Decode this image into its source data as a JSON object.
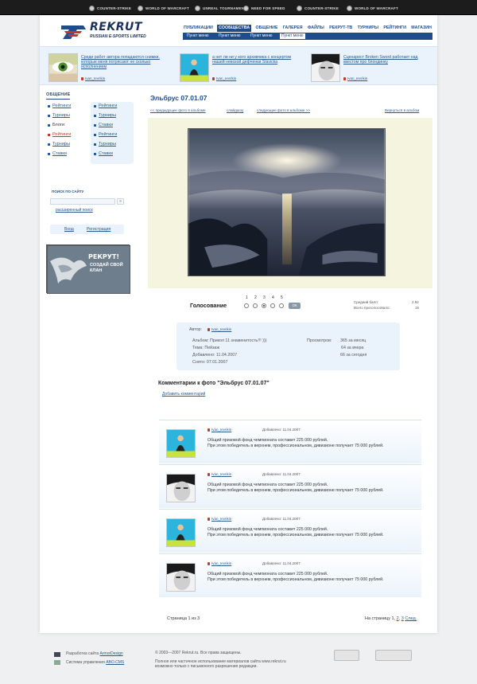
{
  "topbar": {
    "items": [
      "COUNTER-STRIKE",
      "WORLD OF WARCRAFT",
      "UNREAL TOURNAMENT",
      "NEED FOR SPEED",
      "COUNTER-STRIKE",
      "WORLD OF WARCRAFT"
    ]
  },
  "logo": {
    "name": "REKRUT",
    "subtitle": "RUSSIAN E-SPORTS LIMITED"
  },
  "nav": {
    "items": [
      "ПУБЛИКАЦИИ",
      "СООБЩЕСТВА",
      "ОБЩЕНИЕ",
      "ГАЛЕРЕЯ",
      "ФАЙЛЫ",
      "РЕКРУТ-ТВ",
      "ТУРНИРЫ",
      "РЕЙТИНГИ",
      "МАГАЗИН"
    ],
    "active_index": 1,
    "sub_items": [
      "Пункт меню",
      "Пункт меню",
      "Пункт меню",
      "Пункт меню"
    ]
  },
  "teasers": [
    {
      "text": "Среди работ автора попадаются снимки, которые меня потрясают не сколько исполнением",
      "author": "Ivan_Ievrikin"
    },
    {
      "text": "а нет ли ни у кого архивчика с концертом нашей невской дефченки Slavicka",
      "author": "Ivan_Ievrikin"
    },
    {
      "text": "Сценарист Broken Sword работает над квестом про блондинку",
      "author": "Ivan_Ievrikin"
    }
  ],
  "sidebar": {
    "community_title": "ОБЩЕНИЕ",
    "col1": [
      "Рейтинги",
      "Турниры",
      "Блоги",
      "Рейтинги",
      "Турниры",
      "Ставки"
    ],
    "col2": [
      "Рейтинги",
      "Турниры",
      "Ставки",
      "Рейтинги",
      "Турниры",
      "Ставки"
    ],
    "search_title": "ПОИСК ПО САЙТУ",
    "search_placeholder": "",
    "search_button": "»",
    "advanced_search": "расширенный поиск",
    "login": "Вход",
    "register": "Регистрация",
    "banner_title": "РЕКРУТ!",
    "banner_text": "СОЗДАЙ СВОЙ КЛАН"
  },
  "photo": {
    "title": "Эльбрус 07.01.07",
    "prev": "<< предыдущее фото в альбоме",
    "slideshow": "слайдшоу",
    "next": "следующее фото в альбоме >>",
    "back": "Вернуться в альбом"
  },
  "voting": {
    "title": "Голосование",
    "options": [
      "1",
      "2",
      "3",
      "4",
      "5"
    ],
    "selected_index": 2,
    "button": "ОК",
    "avg_label": "Средний балл:",
    "avg_value": "2.92",
    "total_label": "Всего проголосовало:",
    "total_value": "15"
  },
  "info": {
    "author_label": "Автор:",
    "author": "Ivan_Ievrikin",
    "album": "Альбом: Прикол 11 знаменитость!!! )))",
    "theme": "Тема: Пейзаж",
    "added": "Добавлено: 11.04.2007",
    "shot": "Снято:   07.01.2007",
    "views_label": "Просмотров:",
    "views_month": "365 за месяц",
    "views_yesterday": "64 за вчера",
    "views_today": "66 за сегодня"
  },
  "comments": {
    "title": "Комментарии к фото \"Эльбрус 07.01.07\"",
    "add": "Добавить комментарий",
    "items": [
      {
        "author": "Ivan_Ievrikin",
        "date": "Добавлено: 11.04.2007",
        "text1": "Общий призовой фонд чемпионата составит 225 000 рублей.",
        "text2": "При этом победитель в верхнем, профессиональном, дивизионе получает 75 000 рублей."
      },
      {
        "author": "Ivan_Ievrikin",
        "date": "Добавлено: 11.04.2007",
        "text1": "Общий призовой фонд чемпионата составит 225 000 рублей.",
        "text2": "При этом победитель в верхнем, профессиональном, дивизионе получает 75 000 рублей."
      },
      {
        "author": "Ivan_Ievrikin",
        "date": "Добавлено: 11.04.2007",
        "text1": "Общий призовой фонд чемпионата составит 225 000 рублей.",
        "text2": "При этом победитель в верхнем, профессиональном, дивизионе получает 75 000 рублей."
      },
      {
        "author": "Ivan_Ievrikin",
        "date": "Добавлено: 11.04.2007",
        "text1": "Общий призовой фонд чемпионата составит 225 000 рублей.",
        "text2": "При этом победитель в верхнем, профессиональном, дивизионе получает 75 000 рублей."
      }
    ]
  },
  "pager": {
    "left": "Страница 1 из 3",
    "right_label": "На страницу",
    "pages": [
      "1",
      "2",
      "3"
    ],
    "next": "След."
  },
  "footer": {
    "dev_label": "Разработка сайта",
    "dev_link": "ArmorDesign",
    "cms_label": "Система управления",
    "cms_link": "ABO.CMS",
    "copyright": "© 2003—2007 Rekrut.ru. Все права защищены.",
    "notice1": "Полное или частичное использование материалов сайта www.rekrut.ru",
    "notice2": "возможно только с письменного разрешения редакции.",
    "badge1": "",
    "badge2": ""
  },
  "colors": {
    "brand": "#1e4d8a",
    "link": "#2a5a93",
    "accent_red": "#c0392b",
    "panel": "#eaf3fb",
    "photo_bg": "#f5f4df"
  }
}
